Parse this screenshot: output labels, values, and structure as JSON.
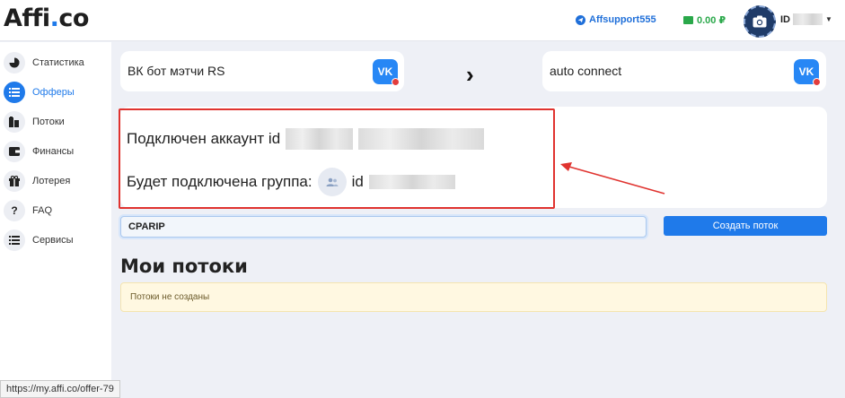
{
  "header": {
    "logo_main": "Affi",
    "logo_dot": ".",
    "logo_end": "co",
    "support_label": "Affsupport555",
    "balance_label": "0.00 ₽",
    "user_prefix": "ID"
  },
  "sidebar": {
    "items": [
      {
        "label": "Статистика",
        "icon": "chart-icon"
      },
      {
        "label": "Офферы",
        "icon": "list-icon"
      },
      {
        "label": "Потоки",
        "icon": "streams-icon"
      },
      {
        "label": "Финансы",
        "icon": "wallet-icon"
      },
      {
        "label": "Лотерея",
        "icon": "gift-icon"
      },
      {
        "label": "FAQ",
        "icon": "question-icon"
      },
      {
        "label": "Сервисы",
        "icon": "services-icon"
      }
    ],
    "active_index": 1
  },
  "bots": {
    "left_title": "ВК бот мэтчи RS",
    "right_title": "auto connect",
    "vk_label": "VK"
  },
  "connection": {
    "account_text": "Подключен аккаунт id",
    "group_text": "Будет подключена группа:",
    "group_id_prefix": "id"
  },
  "stream_form": {
    "input_value": "CPARIP",
    "create_button": "Создать поток"
  },
  "streams": {
    "title": "Мои потоки",
    "empty_notice": "Потоки не созданы"
  },
  "status_bar": {
    "url": "https://my.affi.co/offer-79"
  },
  "colors": {
    "accent": "#1f7aea",
    "balance": "#2aa84a",
    "highlight": "#e0332f",
    "vk": "#2787f5"
  }
}
